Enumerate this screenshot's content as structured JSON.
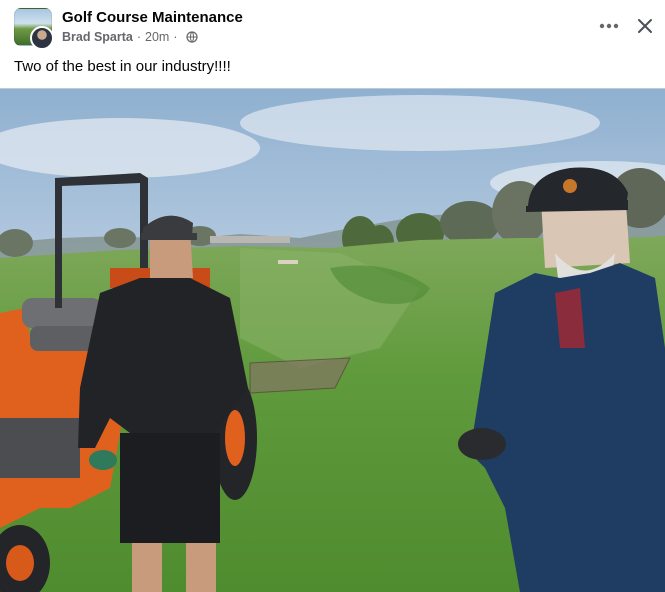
{
  "post": {
    "group_name": "Golf Course Maintenance",
    "author": "Brad Sparta",
    "time": "20m",
    "separator": "·",
    "text": "Two of the best in our industry!!!!"
  },
  "icons": {
    "more": "more-horizontal-icon",
    "close": "close-icon",
    "audience": "globe-icon"
  },
  "colors": {
    "text_primary": "#050505",
    "text_secondary": "#65676b",
    "background": "#ffffff"
  }
}
